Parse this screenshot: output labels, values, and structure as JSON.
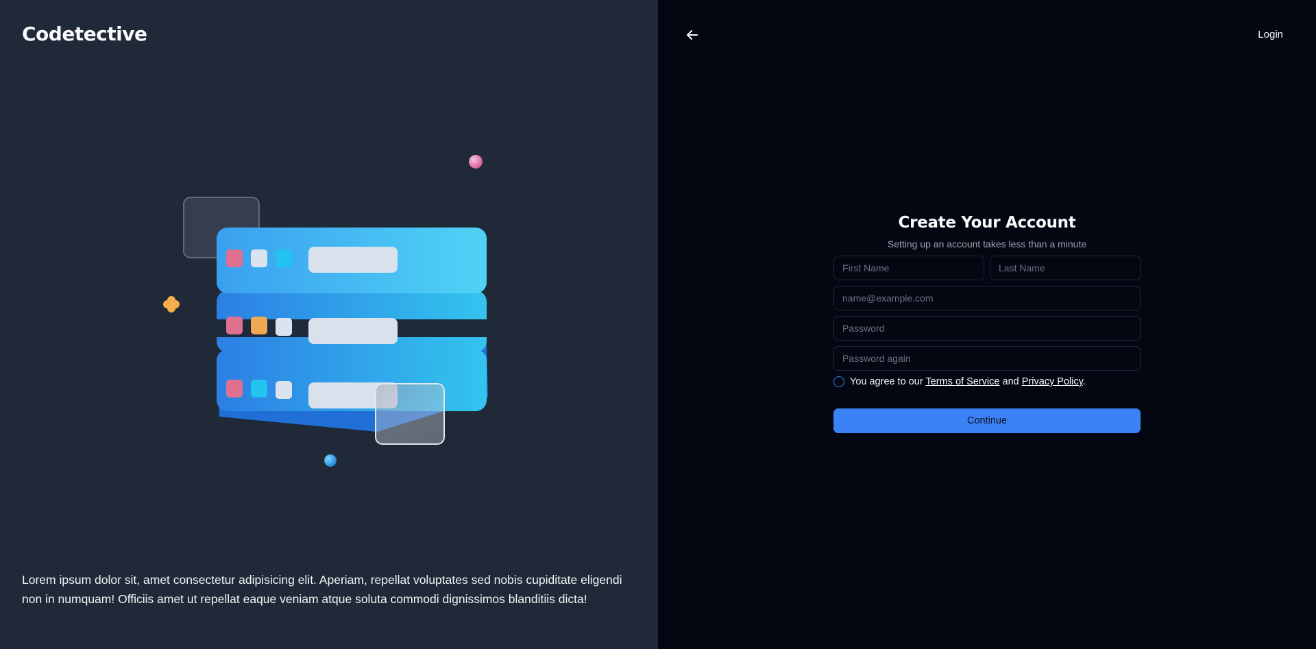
{
  "brand": {
    "name": "Codetective"
  },
  "left": {
    "blurb": "Lorem ipsum dolor sit, amet consectetur adipisicing elit. Aperiam, repellat voluptates sed nobis cupiditate eligendi non in numquam! Officiis amet ut repellat eaque veniam atque soluta commodi dignissimos blanditiis dicta!",
    "illustration": "server-stack-icon"
  },
  "header": {
    "back_icon": "arrow-left-icon",
    "login_label": "Login"
  },
  "form": {
    "title": "Create Your Account",
    "subtitle": "Setting up an account takes less than a minute",
    "first_name": {
      "placeholder": "First Name",
      "value": ""
    },
    "last_name": {
      "placeholder": "Last Name",
      "value": ""
    },
    "email": {
      "placeholder": "name@example.com",
      "value": ""
    },
    "password": {
      "placeholder": "Password",
      "value": ""
    },
    "password_again": {
      "placeholder": "Password again",
      "value": ""
    },
    "agree": {
      "prefix": "You agree to our",
      "terms": "Terms of Service",
      "and": "and",
      "privacy": "Privacy Policy",
      "suffix": "."
    },
    "continue_label": "Continue"
  },
  "colors": {
    "left_bg": "#1f2937",
    "right_bg": "#030712",
    "accent": "#3b82f6"
  }
}
